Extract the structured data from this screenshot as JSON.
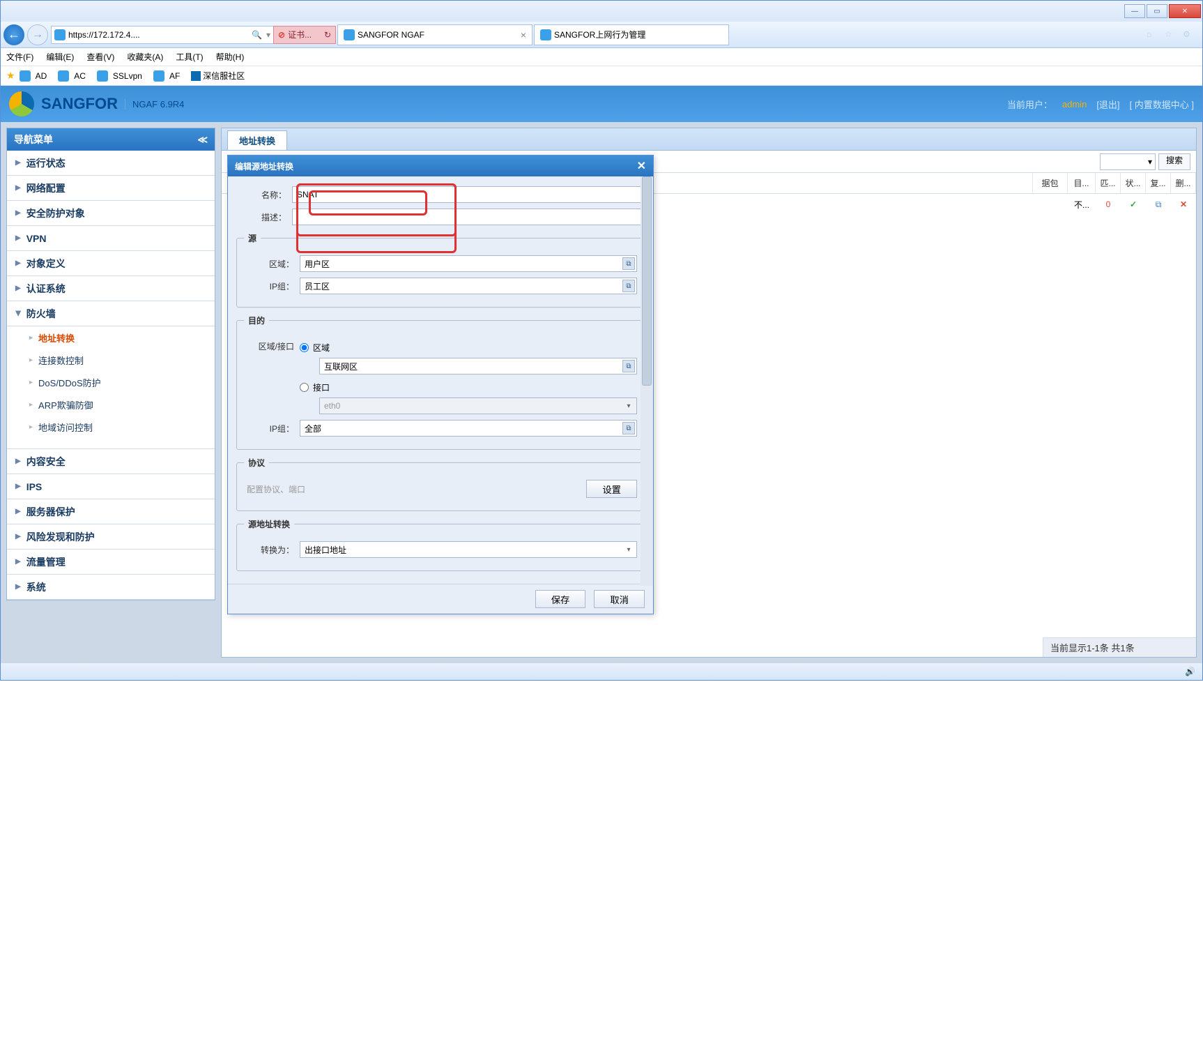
{
  "window": {
    "minimize": "—",
    "maximize": "▭",
    "close": "✕"
  },
  "browser": {
    "url": "https://172.172.4....",
    "search_hint": "🔍",
    "cert_error": "证书...",
    "refresh": "↻",
    "tabs": [
      {
        "title": "SANGFOR NGAF"
      },
      {
        "title": "SANGFOR上网行为管理"
      }
    ]
  },
  "menubar": [
    "文件(F)",
    "编辑(E)",
    "查看(V)",
    "收藏夹(A)",
    "工具(T)",
    "帮助(H)"
  ],
  "bookmarks": [
    "AD",
    "AC",
    "SSLvpn",
    "AF",
    "深信服社区"
  ],
  "app_header": {
    "brand": "SANGFOR",
    "product": "NGAF 6.9R4",
    "current_user_label": "当前用户：",
    "username": "admin",
    "logout": "[退出]",
    "data_center": "[ 内置数据中心 ]"
  },
  "sidebar": {
    "title": "导航菜单",
    "collapse": "≪",
    "items": [
      {
        "label": "运行状态"
      },
      {
        "label": "网络配置"
      },
      {
        "label": "安全防护对象"
      },
      {
        "label": "VPN"
      },
      {
        "label": "对象定义"
      },
      {
        "label": "认证系统"
      },
      {
        "label": "防火墙",
        "expanded": true,
        "children": [
          {
            "label": "地址转换",
            "active": true
          },
          {
            "label": "连接数控制"
          },
          {
            "label": "DoS/DDoS防护"
          },
          {
            "label": "ARP欺骗防御"
          },
          {
            "label": "地域访问控制"
          }
        ]
      },
      {
        "label": "内容安全"
      },
      {
        "label": "IPS"
      },
      {
        "label": "服务器保护"
      },
      {
        "label": "风险发现和防护"
      },
      {
        "label": "流量管理"
      },
      {
        "label": "系统"
      }
    ]
  },
  "content": {
    "tab": "地址转换",
    "search_button": "搜索",
    "table_headers_partial": [
      "据包",
      "目...",
      "匹...",
      "状...",
      "复...",
      "删..."
    ],
    "row": {
      "c1": "不...",
      "c2": "0"
    },
    "footer": "当前显示1-1条 共1条"
  },
  "dialog": {
    "title": "编辑源地址转换",
    "close": "✕",
    "name_label": "名称：",
    "name_value": "SNAT",
    "desc_label": "描述：",
    "desc_value": "",
    "section_source": "源",
    "zone_label": "区域：",
    "zone_value": "用户区",
    "ipgroup_label": "IP组：",
    "ipgroup_value": "员工区",
    "section_dest": "目的",
    "zone_iface_label": "区域/接口",
    "radio_zone": "区域",
    "dest_zone_value": "互联网区",
    "radio_iface": "接口",
    "iface_value": "eth0",
    "dest_ipgroup_label": "IP组：",
    "dest_ipgroup_value": "全部",
    "section_proto": "协议",
    "proto_hint": "配置协议、端口",
    "settings_btn": "设置",
    "section_snat": "源地址转换",
    "convert_label": "转换为：",
    "convert_value": "出接口地址",
    "save_btn": "保存",
    "cancel_btn": "取消"
  }
}
